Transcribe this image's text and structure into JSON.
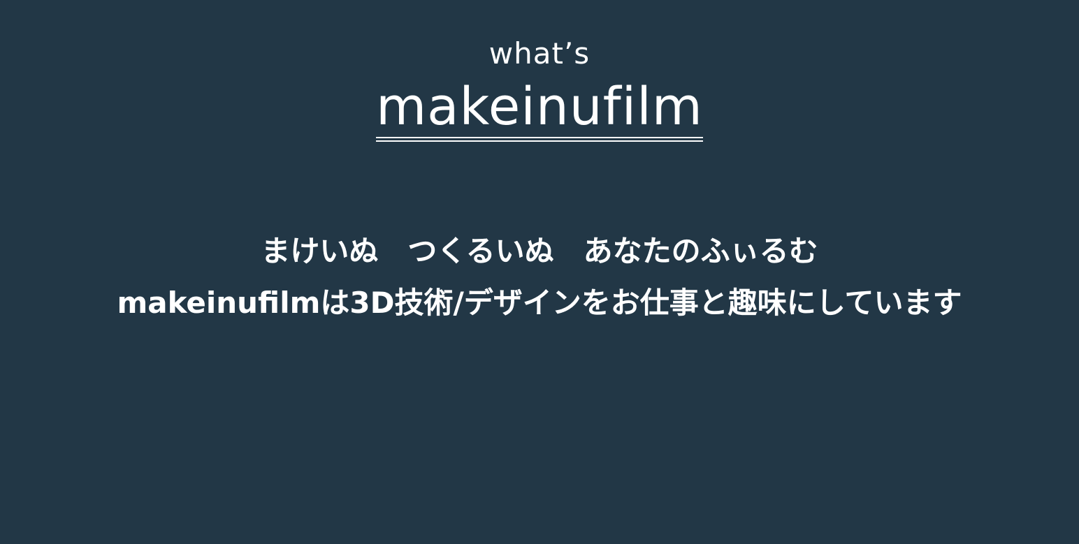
{
  "header": {
    "subtitle": "what’s",
    "title": "makeinufilm"
  },
  "intro": {
    "line1": "まけいぬ　つくるいぬ　あなたのふぃるむ",
    "line2": "makeinufilmは3D技術/デザインをお仕事と趣味にしています"
  },
  "colors": {
    "background": "#223746",
    "text": "#ffffff"
  }
}
